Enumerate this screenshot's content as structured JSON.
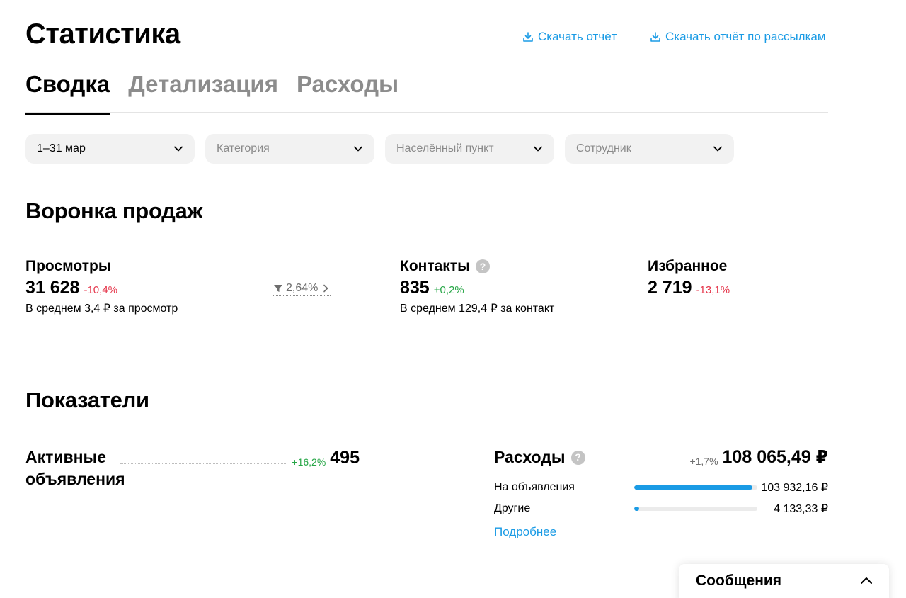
{
  "header": {
    "title": "Статистика",
    "download_report": "Скачать отчёт",
    "download_mailing_report": "Скачать отчёт по рассылкам"
  },
  "tabs": [
    {
      "label": "Сводка",
      "active": true
    },
    {
      "label": "Детализация",
      "active": false
    },
    {
      "label": "Расходы",
      "active": false
    }
  ],
  "filters": {
    "period": "1–31 мар",
    "category": "Категория",
    "location": "Населённый пункт",
    "employee": "Сотрудник"
  },
  "funnel": {
    "title": "Воронка продаж",
    "views": {
      "label": "Просмотры",
      "value": "31 628",
      "change": "-10,4%",
      "sub": "В среднем 3,4 ₽ за просмотр"
    },
    "conversion": "2,64%",
    "contacts": {
      "label": "Контакты",
      "value": "835",
      "change": "+0,2%",
      "sub": "В среднем 129,4 ₽ за контакт"
    },
    "favorites": {
      "label": "Избранное",
      "value": "2 719",
      "change": "-13,1%"
    }
  },
  "metrics": {
    "title": "Показатели",
    "active_ads": {
      "label": "Активные объявления",
      "change": "+16,2%",
      "value": "495"
    },
    "expenses": {
      "label": "Расходы",
      "change": "+1,7%",
      "value": "108 065,49 ₽",
      "items": [
        {
          "label": "На объявления",
          "value": "103 932,16 ₽",
          "share": 0.962
        },
        {
          "label": "Другие",
          "value": "4 133,33 ₽",
          "share": 0.038
        }
      ],
      "more": "Подробнее"
    }
  },
  "messages": {
    "label": "Сообщения"
  },
  "colors": {
    "accent": "#1a9be5",
    "negative": "#e5364b",
    "positive": "#26a646"
  }
}
